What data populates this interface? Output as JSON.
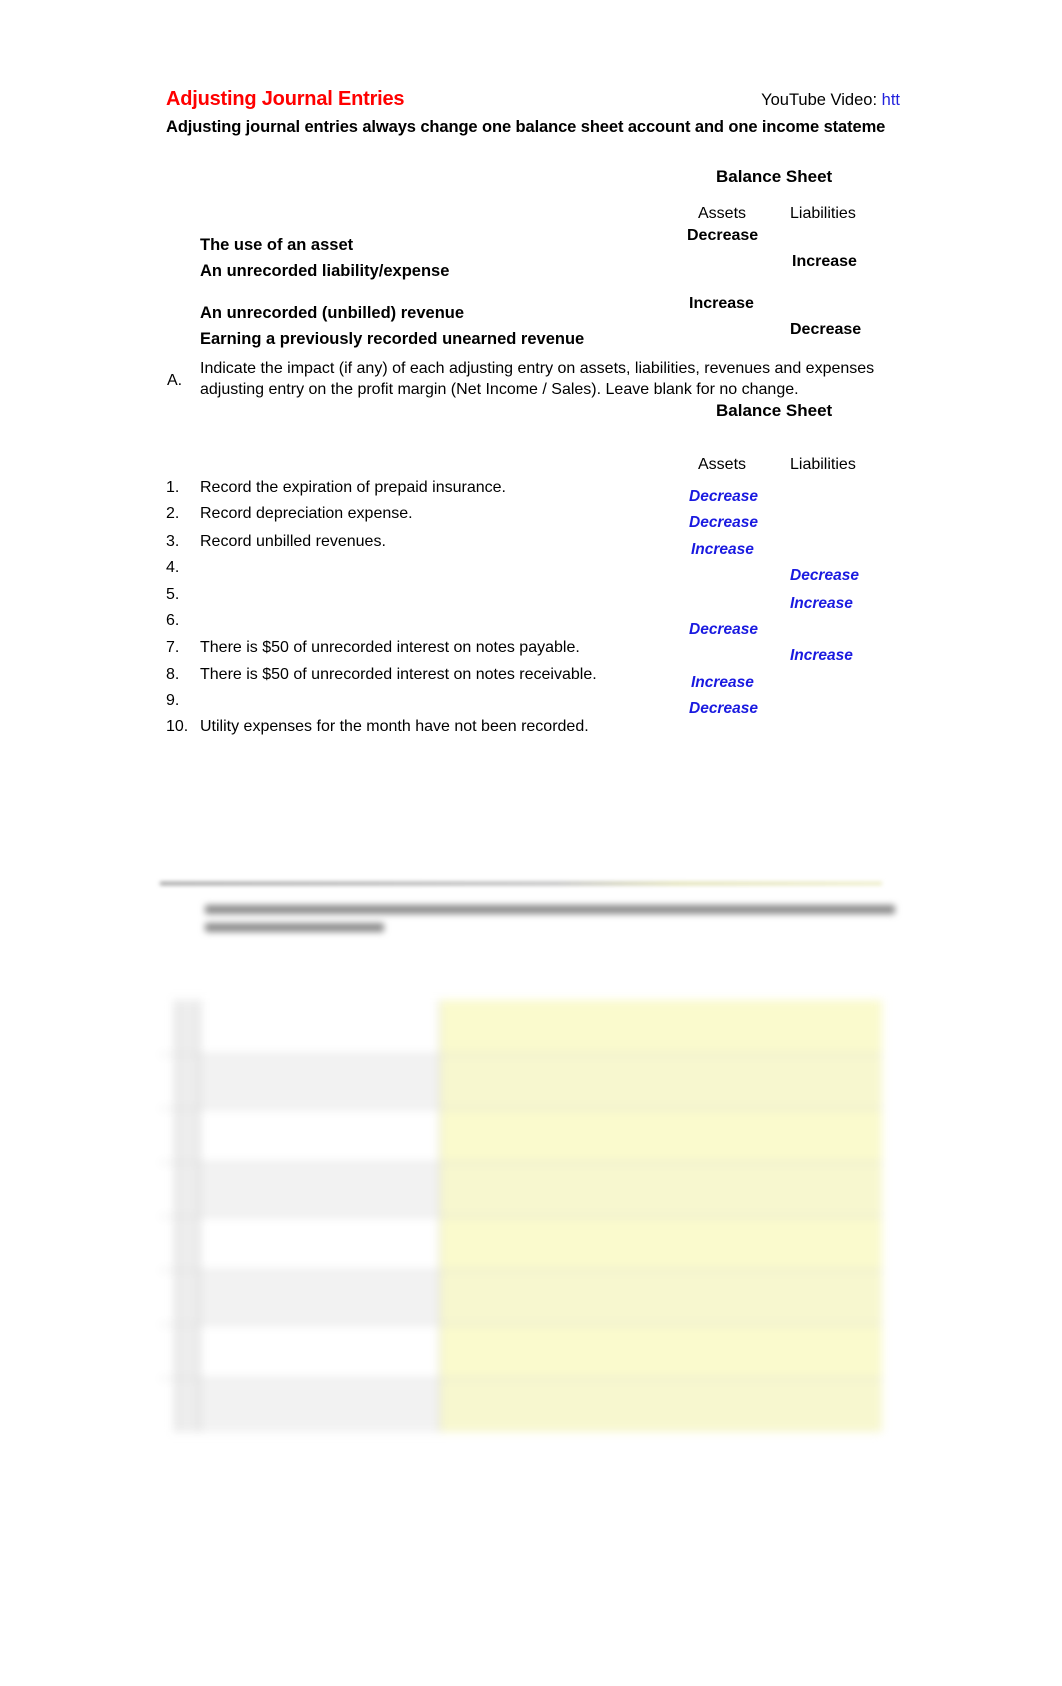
{
  "document": {
    "title": "Adjusting Journal Entries",
    "title_color": "#FF0000",
    "subtitle": "Adjusting journal entries always change one balance sheet account and one income stateme",
    "youtube_label": "YouTube Video:",
    "youtube_link_text": "htt",
    "link_color": "#2222DD",
    "value_color": "#1A1AE0"
  },
  "concept_table": {
    "section_header": "Balance Sheet",
    "columns": [
      "Assets",
      "Liabilities"
    ],
    "rows": [
      {
        "label": "The use of an asset",
        "assets": "Decrease",
        "liabilities": ""
      },
      {
        "label": "An unrecorded liability/expense",
        "assets": "",
        "liabilities": "Increase"
      },
      {
        "label": "An unrecorded (unbilled) revenue",
        "assets": "Increase",
        "liabilities": ""
      },
      {
        "label": "Earning a previously recorded unearned revenue",
        "assets": "",
        "liabilities": "Decrease"
      }
    ]
  },
  "question_a": {
    "marker": "A.",
    "text": "Indicate the impact (if any) of each adjusting entry on assets, liabilities, revenues and expenses\nadjusting entry on the profit margin (Net Income / Sales).  Leave blank for no change.",
    "section_header": "Balance Sheet",
    "columns": [
      "Assets",
      "Liabilities"
    ],
    "items": [
      {
        "num": "1.",
        "text": "Record the expiration of prepaid insurance.",
        "assets": "Decrease",
        "liabilities": ""
      },
      {
        "num": "2.",
        "text": "Record depreciation expense.",
        "assets": "Decrease",
        "liabilities": ""
      },
      {
        "num": "3.",
        "text": "Record unbilled revenues.",
        "assets": "Increase",
        "liabilities": ""
      },
      {
        "num": "4.",
        "text": "",
        "assets": "",
        "liabilities": "Decrease"
      },
      {
        "num": "5.",
        "text": "",
        "assets": "",
        "liabilities": "Increase"
      },
      {
        "num": "6.",
        "text": "",
        "assets": "Decrease",
        "liabilities": ""
      },
      {
        "num": "7.",
        "text": "There is $50 of unrecorded interest on notes payable.",
        "assets": "",
        "liabilities": "Increase"
      },
      {
        "num": "8.",
        "text": "There is $50 of unrecorded interest on notes receivable.",
        "assets": "Increase",
        "liabilities": ""
      },
      {
        "num": "9.",
        "text": "",
        "assets": "Decrease",
        "liabilities": ""
      },
      {
        "num": "10.",
        "text": "Utility expenses for the month have not been recorded.",
        "assets": "",
        "liabilities": ""
      }
    ]
  }
}
